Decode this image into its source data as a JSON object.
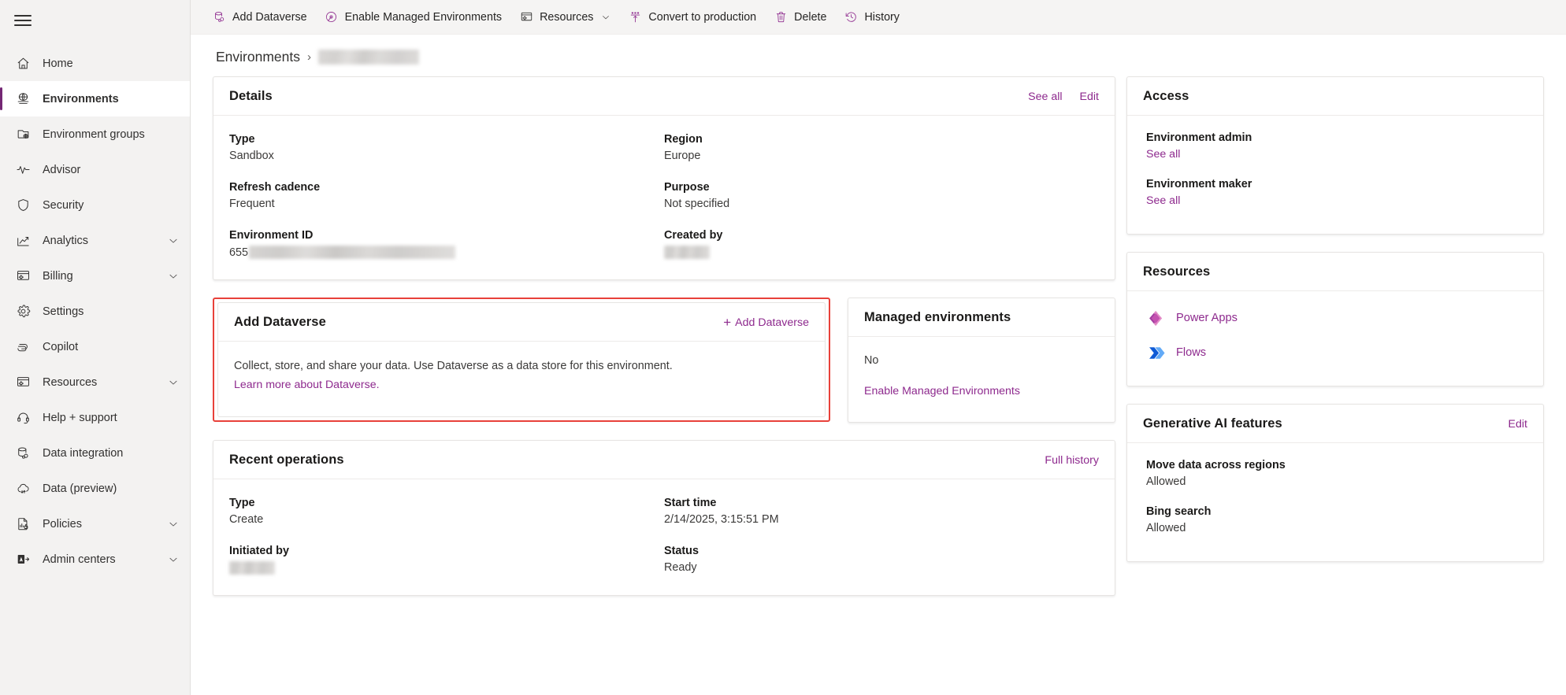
{
  "sidebar": {
    "hamburger_name": "global-nav-toggle",
    "items": [
      {
        "label": "Home",
        "icon": "home-icon",
        "active": false,
        "expandable": false
      },
      {
        "label": "Environments",
        "icon": "environments-icon",
        "active": true,
        "expandable": false
      },
      {
        "label": "Environment groups",
        "icon": "environment-groups-icon",
        "active": false,
        "expandable": false
      },
      {
        "label": "Advisor",
        "icon": "advisor-pulse-icon",
        "active": false,
        "expandable": false
      },
      {
        "label": "Security",
        "icon": "shield-icon",
        "active": false,
        "expandable": false
      },
      {
        "label": "Analytics",
        "icon": "analytics-chart-icon",
        "active": false,
        "expandable": true
      },
      {
        "label": "Billing",
        "icon": "billing-icon",
        "active": false,
        "expandable": true
      },
      {
        "label": "Settings",
        "icon": "gear-icon",
        "active": false,
        "expandable": false
      },
      {
        "label": "Copilot",
        "icon": "copilot-icon",
        "active": false,
        "expandable": false
      },
      {
        "label": "Resources",
        "icon": "resources-icon",
        "active": false,
        "expandable": true
      },
      {
        "label": "Help + support",
        "icon": "headset-icon",
        "active": false,
        "expandable": false
      },
      {
        "label": "Data integration",
        "icon": "database-link-icon",
        "active": false,
        "expandable": false
      },
      {
        "label": "Data (preview)",
        "icon": "cloud-sync-icon",
        "active": false,
        "expandable": false
      },
      {
        "label": "Policies",
        "icon": "policy-lock-icon",
        "active": false,
        "expandable": true
      },
      {
        "label": "Admin centers",
        "icon": "admin-centers-icon",
        "active": false,
        "expandable": true
      }
    ]
  },
  "toolbar": {
    "buttons": [
      {
        "label": "Add Dataverse",
        "icon": "add-dataverse-icon",
        "chevron": false
      },
      {
        "label": "Enable Managed Environments",
        "icon": "managed-environments-icon",
        "chevron": false
      },
      {
        "label": "Resources",
        "icon": "resources-icon",
        "chevron": true
      },
      {
        "label": "Convert to production",
        "icon": "convert-to-production-icon",
        "chevron": false
      },
      {
        "label": "Delete",
        "icon": "trash-icon",
        "chevron": false
      },
      {
        "label": "History",
        "icon": "history-clock-icon",
        "chevron": false
      }
    ]
  },
  "breadcrumb": {
    "root": "Environments",
    "separator": "›",
    "current": ""
  },
  "details": {
    "title": "Details",
    "see_all": "See all",
    "edit": "Edit",
    "fields": [
      {
        "label": "Type",
        "value": "Sandbox"
      },
      {
        "label": "Region",
        "value": "Europe"
      },
      {
        "label": "Refresh cadence",
        "value": "Frequent"
      },
      {
        "label": "Purpose",
        "value": "Not specified"
      },
      {
        "label": "Environment ID",
        "value": "655",
        "redacted": true
      },
      {
        "label": "Created by",
        "value": "",
        "redacted": true
      }
    ]
  },
  "add_dataverse": {
    "title": "Add Dataverse",
    "action_label": "Add Dataverse",
    "plus": "+",
    "description": "Collect, store, and share your data. Use Dataverse as a data store for this environment.",
    "learn_more": "Learn more about Dataverse.",
    "highlight_color": "#e8413a"
  },
  "managed_environments": {
    "title": "Managed environments",
    "value": "No",
    "enable_link": "Enable Managed Environments"
  },
  "recent_operations": {
    "title": "Recent operations",
    "full_history": "Full history",
    "fields": [
      {
        "label": "Type",
        "value": "Create"
      },
      {
        "label": "Start time",
        "value": "2/14/2025, 3:15:51 PM"
      },
      {
        "label": "Initiated by",
        "value": "",
        "redacted": true
      },
      {
        "label": "Status",
        "value": "Ready"
      }
    ]
  },
  "access": {
    "title": "Access",
    "groups": [
      {
        "label": "Environment admin",
        "link": "See all"
      },
      {
        "label": "Environment maker",
        "link": "See all"
      }
    ]
  },
  "resources_card": {
    "title": "Resources",
    "items": [
      {
        "label": "Power Apps",
        "icon": "power-apps-icon"
      },
      {
        "label": "Flows",
        "icon": "power-automate-flows-icon"
      }
    ]
  },
  "generative_ai": {
    "title": "Generative AI features",
    "edit": "Edit",
    "fields": [
      {
        "label": "Move data across regions",
        "value": "Allowed"
      },
      {
        "label": "Bing search",
        "value": "Allowed"
      }
    ]
  },
  "colors": {
    "accent": "#8e2a8e",
    "active_bar": "#742774",
    "sidebar_bg": "#f3f2f1",
    "toolbar_bg": "#f5f4f3",
    "highlight": "#e8413a"
  }
}
